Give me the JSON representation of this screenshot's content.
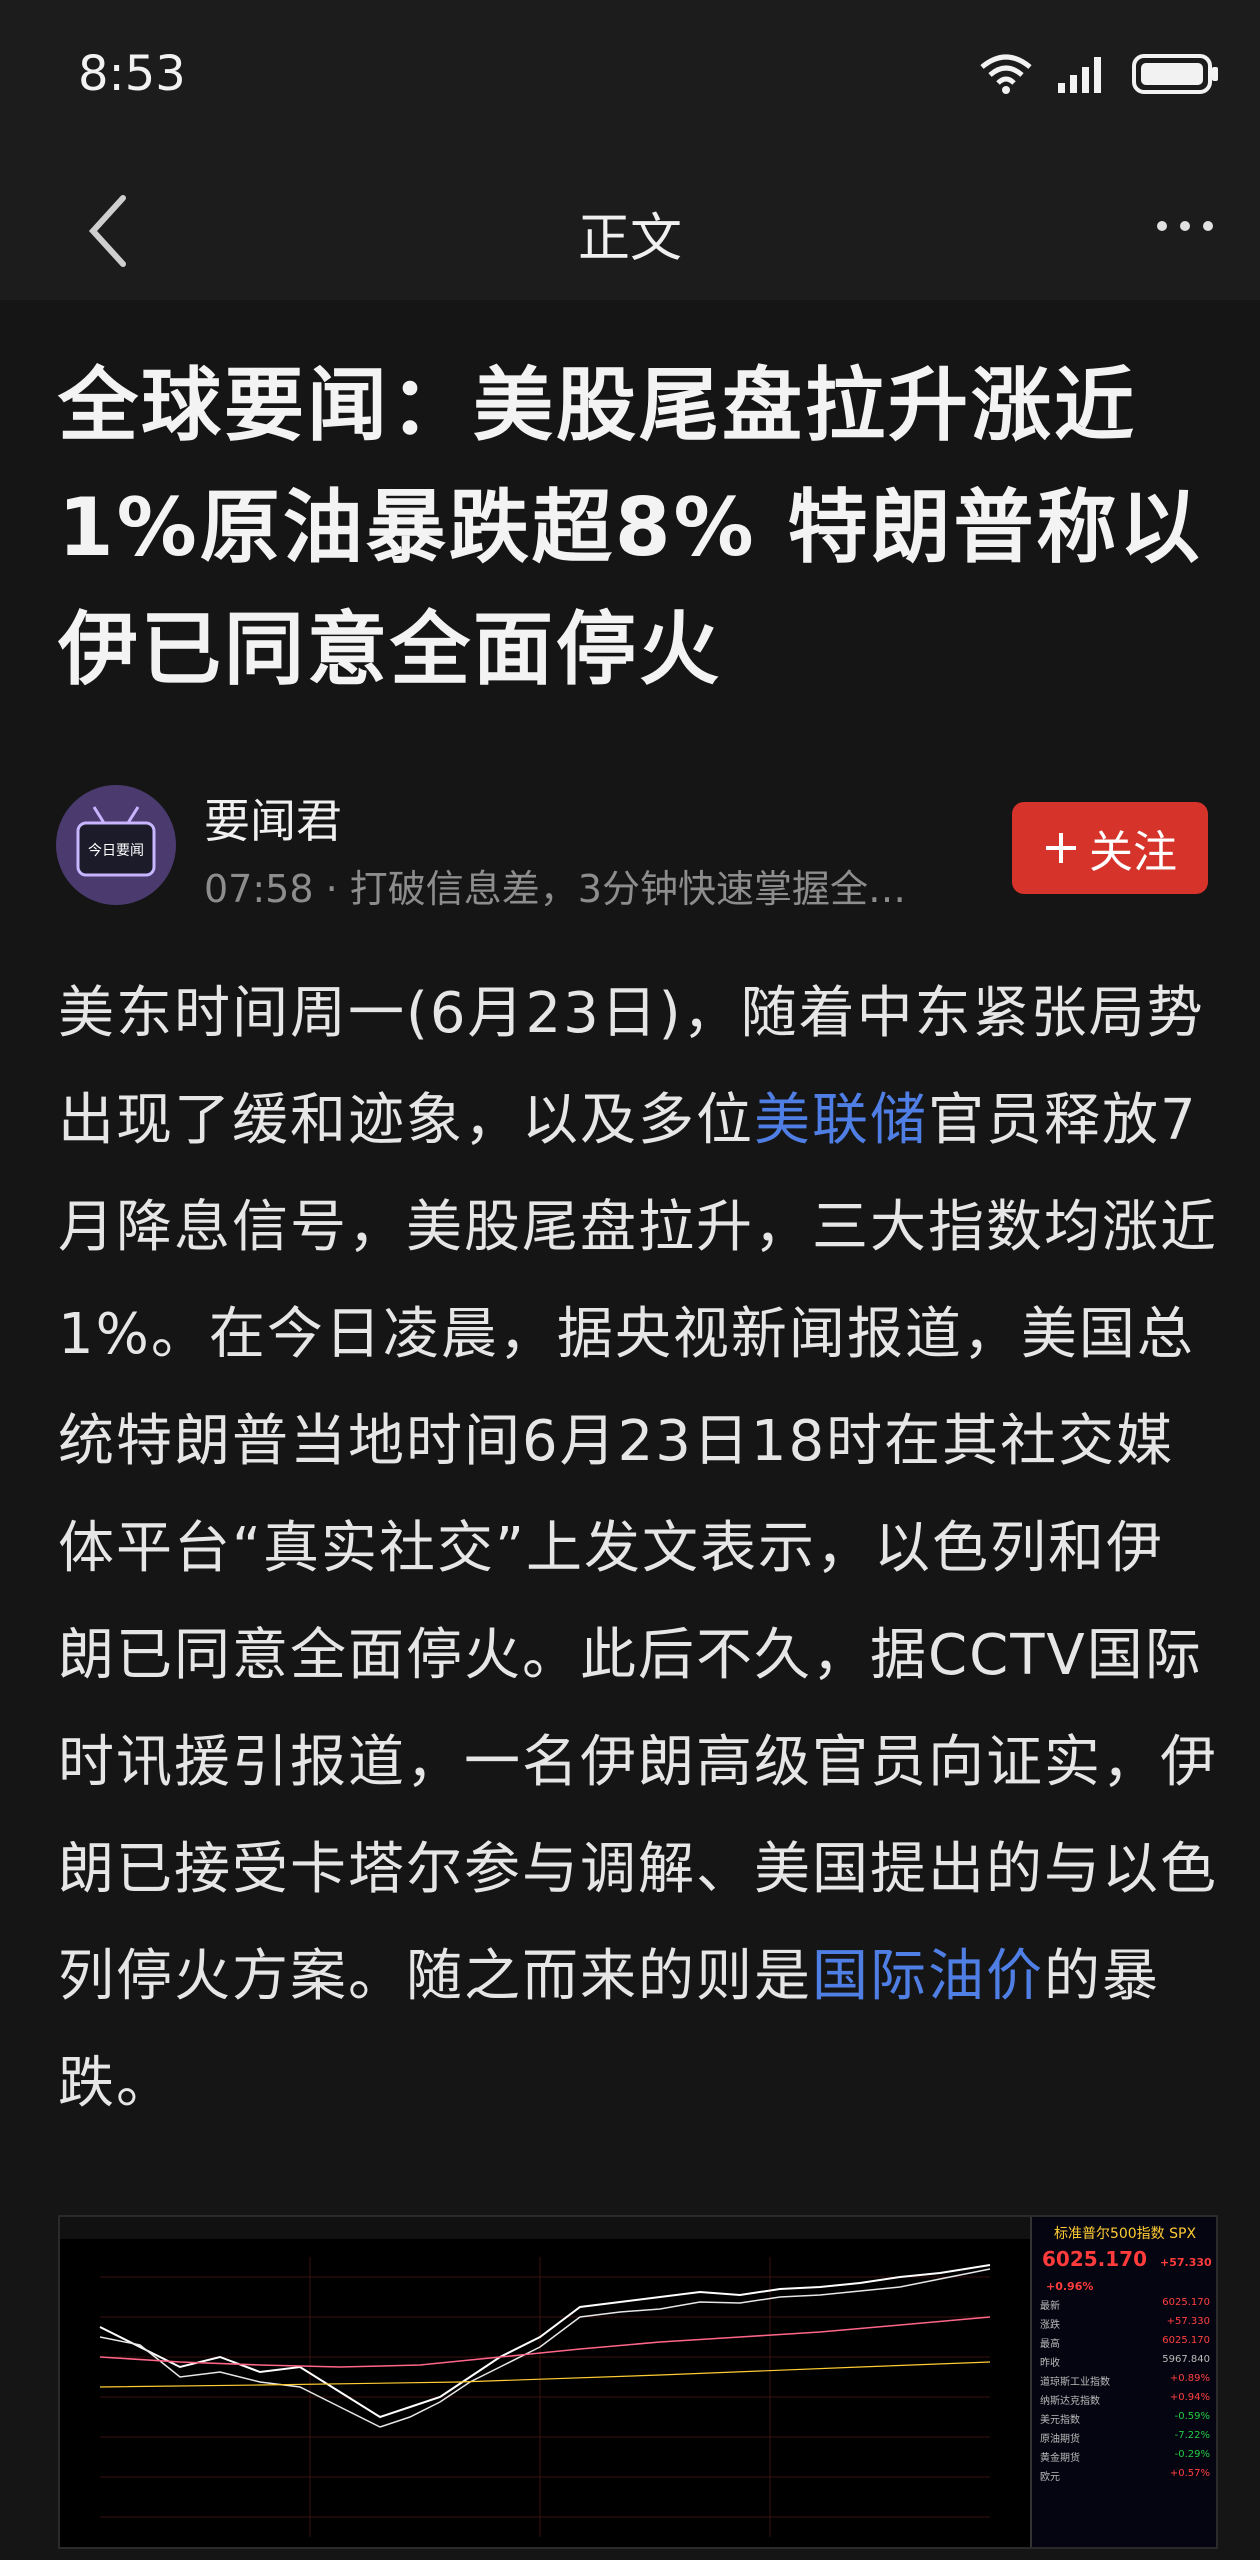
{
  "status_bar": {
    "time": "8:53"
  },
  "nav": {
    "title": "正文"
  },
  "article": {
    "title": "全球要闻：美股尾盘拉升涨近1%原油暴跌超8% 特朗普称以伊已同意全面停火",
    "author": {
      "name": "要闻君",
      "avatar_text": "今日要闻",
      "time": "07:58",
      "desc": "打破信息差，3分钟快速掌握全…"
    },
    "follow_label": "关注",
    "body": {
      "p1": "美东时间周一(6月23日)，随着中东紧张局势出现了缓和迹象，以及多位",
      "link1": "美联储",
      "p2": "官员释放7月降息信号，美股尾盘拉升，三大指数均涨近1%。在今日凌晨，据央视新闻报道，美国总统特朗普当地时间6月23日18时在其社交媒体平台“真实社交”上发文表示，以色列和伊朗已同意全面停火。此后不久，据CCTV国际时讯援引报道，一名伊朗高级官员向证实，伊朗已接受卡塔尔参与调解、美国提出的与以色列停火方案。随之而来的则是",
      "link2": "国际油价",
      "p3": "的暴跌。"
    }
  },
  "chart_image": {
    "panel_title": "标准普尔500指数 SPX",
    "price": "6025.170",
    "change": "+57.330",
    "pct": "+0.96%",
    "rows": [
      {
        "k": "最新",
        "v": "6025.170",
        "c": "r"
      },
      {
        "k": "涨跌",
        "v": "+57.330",
        "c": "r"
      },
      {
        "k": "最高",
        "v": "6025.170",
        "c": "r"
      },
      {
        "k": "昨收",
        "v": "5967.840",
        "c": "w"
      },
      {
        "k": "道琼斯工业指数",
        "v": "+0.89%",
        "c": "r"
      },
      {
        "k": "纳斯达克指数",
        "v": "+0.94%",
        "c": "r"
      },
      {
        "k": "美元指数",
        "v": "-0.59%",
        "c": "g"
      },
      {
        "k": "原油期货",
        "v": "-7.22%",
        "c": "g"
      },
      {
        "k": "黄金期货",
        "v": "-0.29%",
        "c": "g"
      },
      {
        "k": "欧元",
        "v": "+0.57%",
        "c": "r"
      }
    ]
  }
}
